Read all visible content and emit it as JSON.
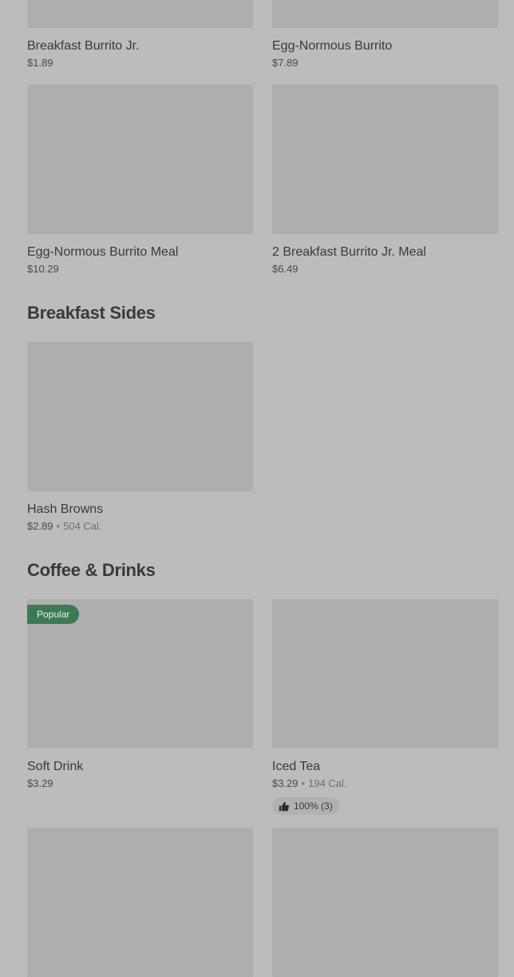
{
  "sections": {
    "breakfast_sides": {
      "title": "Breakfast Sides"
    },
    "coffee_drinks": {
      "title": "Coffee & Drinks"
    }
  },
  "items": {
    "breakfast_burrito_jr": {
      "name": "Breakfast Burrito Jr.",
      "price": "$1.89"
    },
    "egg_normous_burrito": {
      "name": "Egg-Normous Burrito",
      "price": "$7.89"
    },
    "egg_normous_burrito_meal": {
      "name": "Egg-Normous Burrito Meal",
      "price": "$10.29"
    },
    "two_breakfast_burrito_jr_meal": {
      "name": "2 Breakfast Burrito Jr. Meal",
      "price": "$6.49"
    },
    "hash_browns": {
      "name": "Hash Browns",
      "price": "$2.89",
      "calories": "504 Cal."
    },
    "soft_drink": {
      "name": "Soft Drink",
      "price": "$3.29",
      "badge": "Popular"
    },
    "iced_tea": {
      "name": "Iced Tea",
      "price": "$3.29",
      "calories": "194 Cal.",
      "rating": "100% (3)"
    }
  },
  "colors": {
    "badge_bg": "#3b7a55",
    "page_bg": "#bcbcbc",
    "thumb_bg": "#aeaeae"
  },
  "icons": {
    "rating": "thumbs-up-icon"
  }
}
